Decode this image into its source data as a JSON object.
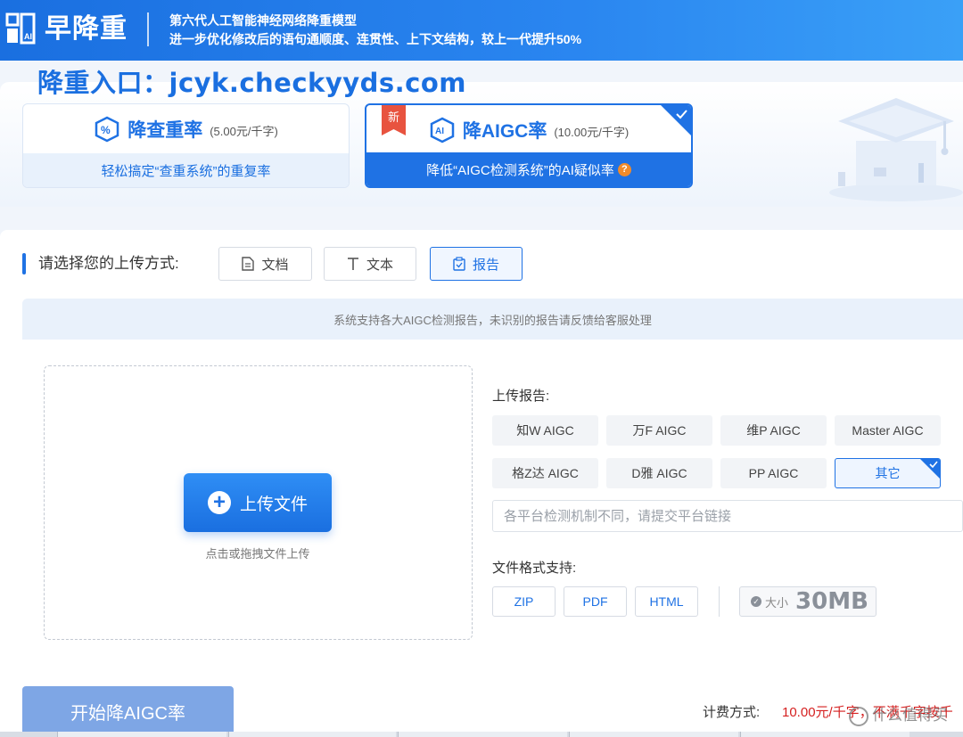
{
  "header": {
    "brand": "早降重",
    "tagline_1": "第六代人工智能神经网络降重模型",
    "tagline_2": "进一步优化修改后的语句通顺度、连贯性、上下文结构，较上一代提升50%"
  },
  "entry_link": "降重入口：jcyk.checkyyds.com",
  "services": [
    {
      "title": "降查重率",
      "price": "(5.00元/千字)",
      "subtitle": "轻松搞定“查重系统”的重复率",
      "icon": "percent-shield-icon",
      "selected": false
    },
    {
      "title": "降AIGC率",
      "price": "(10.00元/千字)",
      "subtitle": "降低“AIGC检测系统”的AI疑似率",
      "icon": "ai-shield-icon",
      "badge": "新",
      "help": "?",
      "selected": true
    }
  ],
  "upload_method": {
    "label": "请选择您的上传方式:",
    "options": [
      {
        "label": "文档",
        "icon": "document-icon"
      },
      {
        "label": "文本",
        "icon": "text-icon"
      },
      {
        "label": "报告",
        "icon": "clipboard-check-icon",
        "selected": true
      }
    ]
  },
  "notice": "系统支持各大AIGC检测报告，未识别的报告请反馈给客服处理",
  "drop_zone": {
    "button": "上传文件",
    "button_icon": "plus-icon",
    "hint": "点击或拖拽文件上传"
  },
  "report": {
    "label": "上传报告:",
    "platforms": [
      "知W AIGC",
      "万F AIGC",
      "维P AIGC",
      "Master AIGC",
      "格Z达 AIGC",
      "D雅 AIGC",
      "PP AIGC",
      "其它"
    ],
    "selected": "其它",
    "link_placeholder": "各平台检测机制不同，请提交平台链接"
  },
  "formats": {
    "label": "文件格式支持:",
    "items": [
      "ZIP",
      "PDF",
      "HTML"
    ],
    "size_label": "大小",
    "size_value": "30MB"
  },
  "footer": {
    "start_button": "开始降AIGC率",
    "fee_label": "计费方式:",
    "fee_value": "10.00元/千字，不满千字按千",
    "watermark": "什么值得买"
  },
  "colors": {
    "brand_blue": "#1f72e4",
    "header_gradient_start": "#1a6fe0",
    "header_gradient_end": "#3aa0f7",
    "badge_red": "#e8533f",
    "fee_red": "#d52020",
    "help_orange": "#f08b2b"
  }
}
